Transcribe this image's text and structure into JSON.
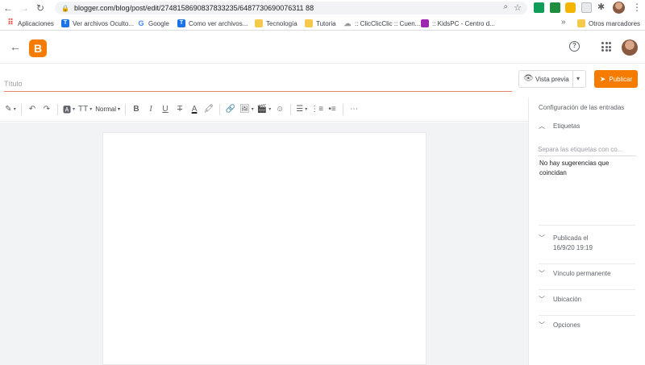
{
  "browser": {
    "url": "blogger.com/blog/post/edit/2748158690837833235/6487730690076311 88",
    "back_icon": "arrow-left-icon",
    "forward_icon": "arrow-right-icon",
    "reload_icon": "reload-icon",
    "bookmarks": [
      {
        "label": "Aplicaciones",
        "icon": "apps-grid-icon"
      },
      {
        "label": "Ver archivos Oculto...",
        "icon": "t-badge-icon"
      },
      {
        "label": "Google",
        "icon": "google-icon"
      },
      {
        "label": "Como ver archivos...",
        "icon": "t-badge-icon"
      },
      {
        "label": "Tecnología",
        "icon": "folder-icon"
      },
      {
        "label": "Tutoria",
        "icon": "folder-icon"
      },
      {
        "label": ":: ClicClicClic :: Cuen...",
        "icon": "cloud-icon"
      },
      {
        "label": ":: KidsPC - Centro d...",
        "icon": "kidspc-icon"
      }
    ],
    "more_bookmarks": "»",
    "other_bookmarks": "Otros marcadores"
  },
  "header": {
    "logo_letter": "B",
    "help_glyph": "?"
  },
  "editor": {
    "title_placeholder": "Título",
    "preview_label": "Vista previa",
    "publish_label": "Publicar",
    "toolbar": {
      "style_label": "Normal",
      "more_glyph": "⋯"
    }
  },
  "panel": {
    "title": "Configuración de las entradas",
    "labels_section": "Etiquetas",
    "labels_placeholder": "Separa las etiquetas con co...",
    "no_suggestions": "No hay sugerencias que coincidan",
    "published_line1": "Publicada el",
    "published_line2": "16/9/20 19:19",
    "permalink": "Vínculo permanente",
    "location": "Ubicación",
    "options": "Opciones"
  },
  "colors": {
    "accent": "#f57c00",
    "title_underline": "#e8846a",
    "editor_bg": "#f1f3f4"
  }
}
